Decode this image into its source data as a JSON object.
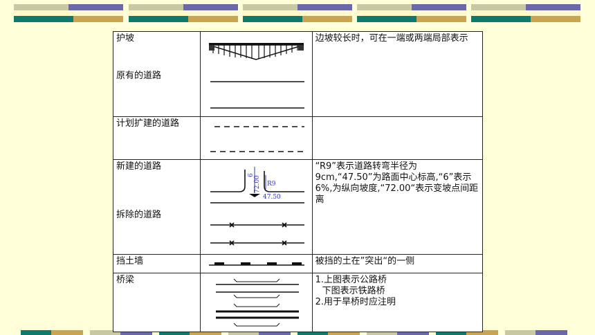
{
  "colors": {
    "background": "#fefed8",
    "deco_teal": "#0d7a6c",
    "deco_gold": "#c9a552",
    "deco_purple": "#6a68a8",
    "deco_khaki": "#c8c8a2",
    "symbol_blue": "#3030c0"
  },
  "rows": [
    {
      "names": [
        "护坡",
        "原有的道路"
      ],
      "description": "边坡较长时，可在一端或两端局部表示"
    },
    {
      "names": [
        "计划扩建的道路"
      ],
      "description": ""
    },
    {
      "names": [
        "新建的道路",
        "拆除的道路"
      ],
      "description": "“R9”表示道路转弯半径为 9cm,“47.50”为路面中心标高,“6”表示 6%,为纵向坡度,“72.00“表示变坡点间距离",
      "symbol_labels": {
        "slope": "6",
        "distance": "72.00",
        "radius": "R9",
        "elevation": "47.50"
      }
    },
    {
      "names": [
        "挡土墙"
      ],
      "description": "被挡的土在”突出“的一侧"
    },
    {
      "names": [
        "桥梁"
      ],
      "description_lines": [
        "1.上图表示公路桥",
        "下图表示铁路桥",
        "2.用于旱桥时应注明"
      ]
    }
  ]
}
